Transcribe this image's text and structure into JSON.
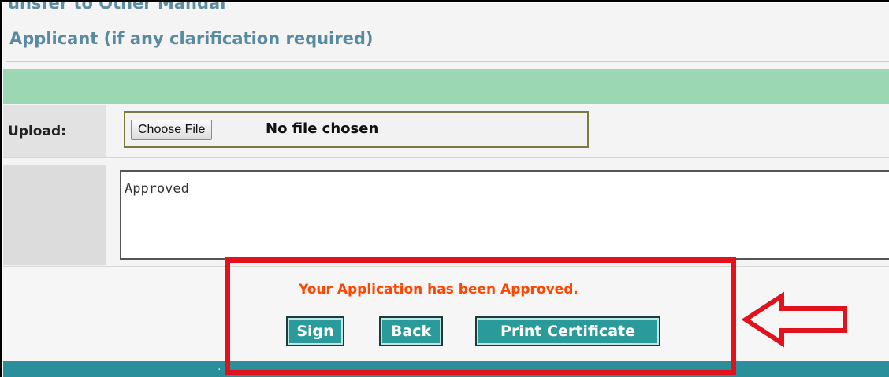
{
  "section_title_cut": "unsfer to Other Mandal",
  "section_title": "Applicant (if any clarification required)",
  "upload": {
    "label": "Upload:",
    "choose_button": "Choose File",
    "status": "No file chosen"
  },
  "remarks": {
    "value": "Approved"
  },
  "message": "Your Application has been Approved.",
  "buttons": {
    "sign": "Sign",
    "back": "Back",
    "print": "Print Certificate"
  },
  "colors": {
    "green_band": "#9bd7b3",
    "teal": "#2a8f9a",
    "button": "#2b9a9a",
    "message": "#ff4500",
    "highlight": "#e1121b",
    "title": "#5a8aa0"
  }
}
